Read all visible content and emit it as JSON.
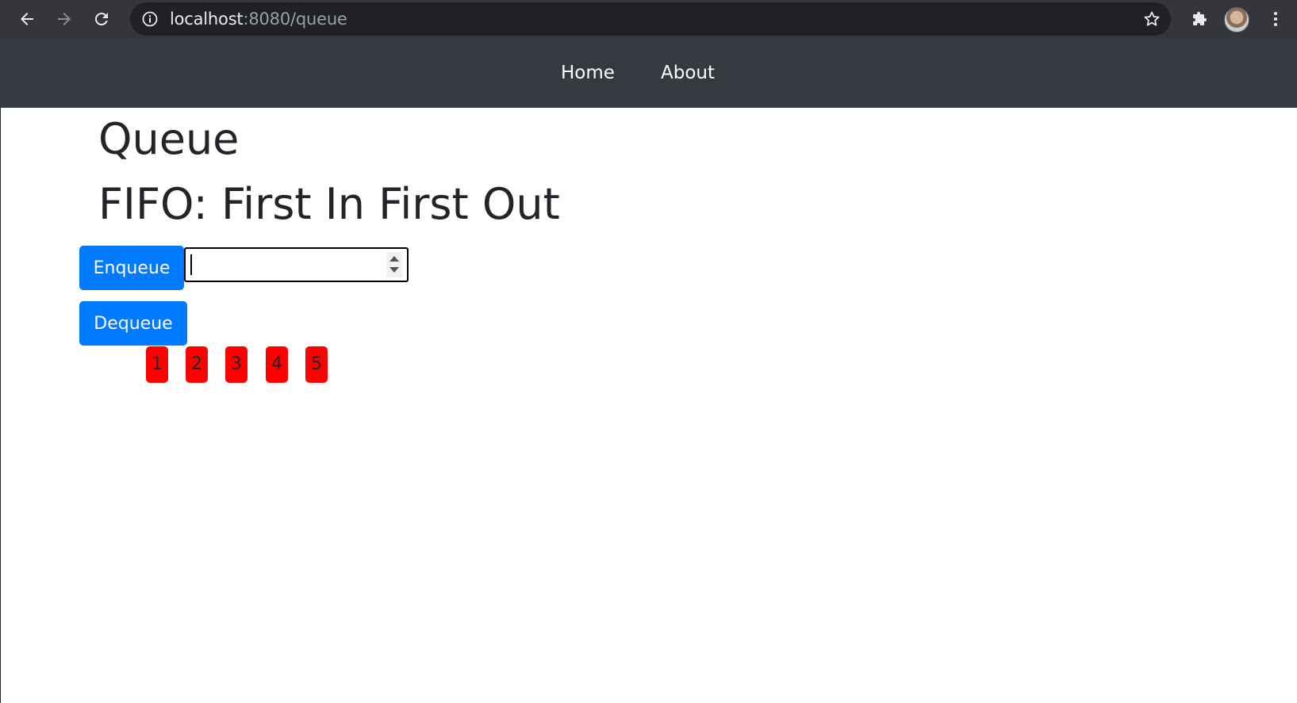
{
  "browser": {
    "url_host": "localhost",
    "url_path": ":8080/queue",
    "icons": [
      "back-arrow-icon",
      "forward-arrow-icon",
      "reload-icon",
      "info-icon",
      "star-icon",
      "extensions-icon",
      "profile-avatar",
      "menu-dots-icon"
    ]
  },
  "nav": {
    "links": [
      {
        "label": "Home"
      },
      {
        "label": "About"
      }
    ],
    "background": "#343a40"
  },
  "main": {
    "title": "Queue",
    "subtitle": "FIFO: First In First Out",
    "enqueue_label": "Enqueue",
    "dequeue_label": "Dequeue",
    "input_value": "",
    "items": [
      "1",
      "2",
      "3",
      "4",
      "5"
    ]
  },
  "colors": {
    "primary": "#007bff",
    "item": "#ff0000",
    "text": "#212529"
  }
}
